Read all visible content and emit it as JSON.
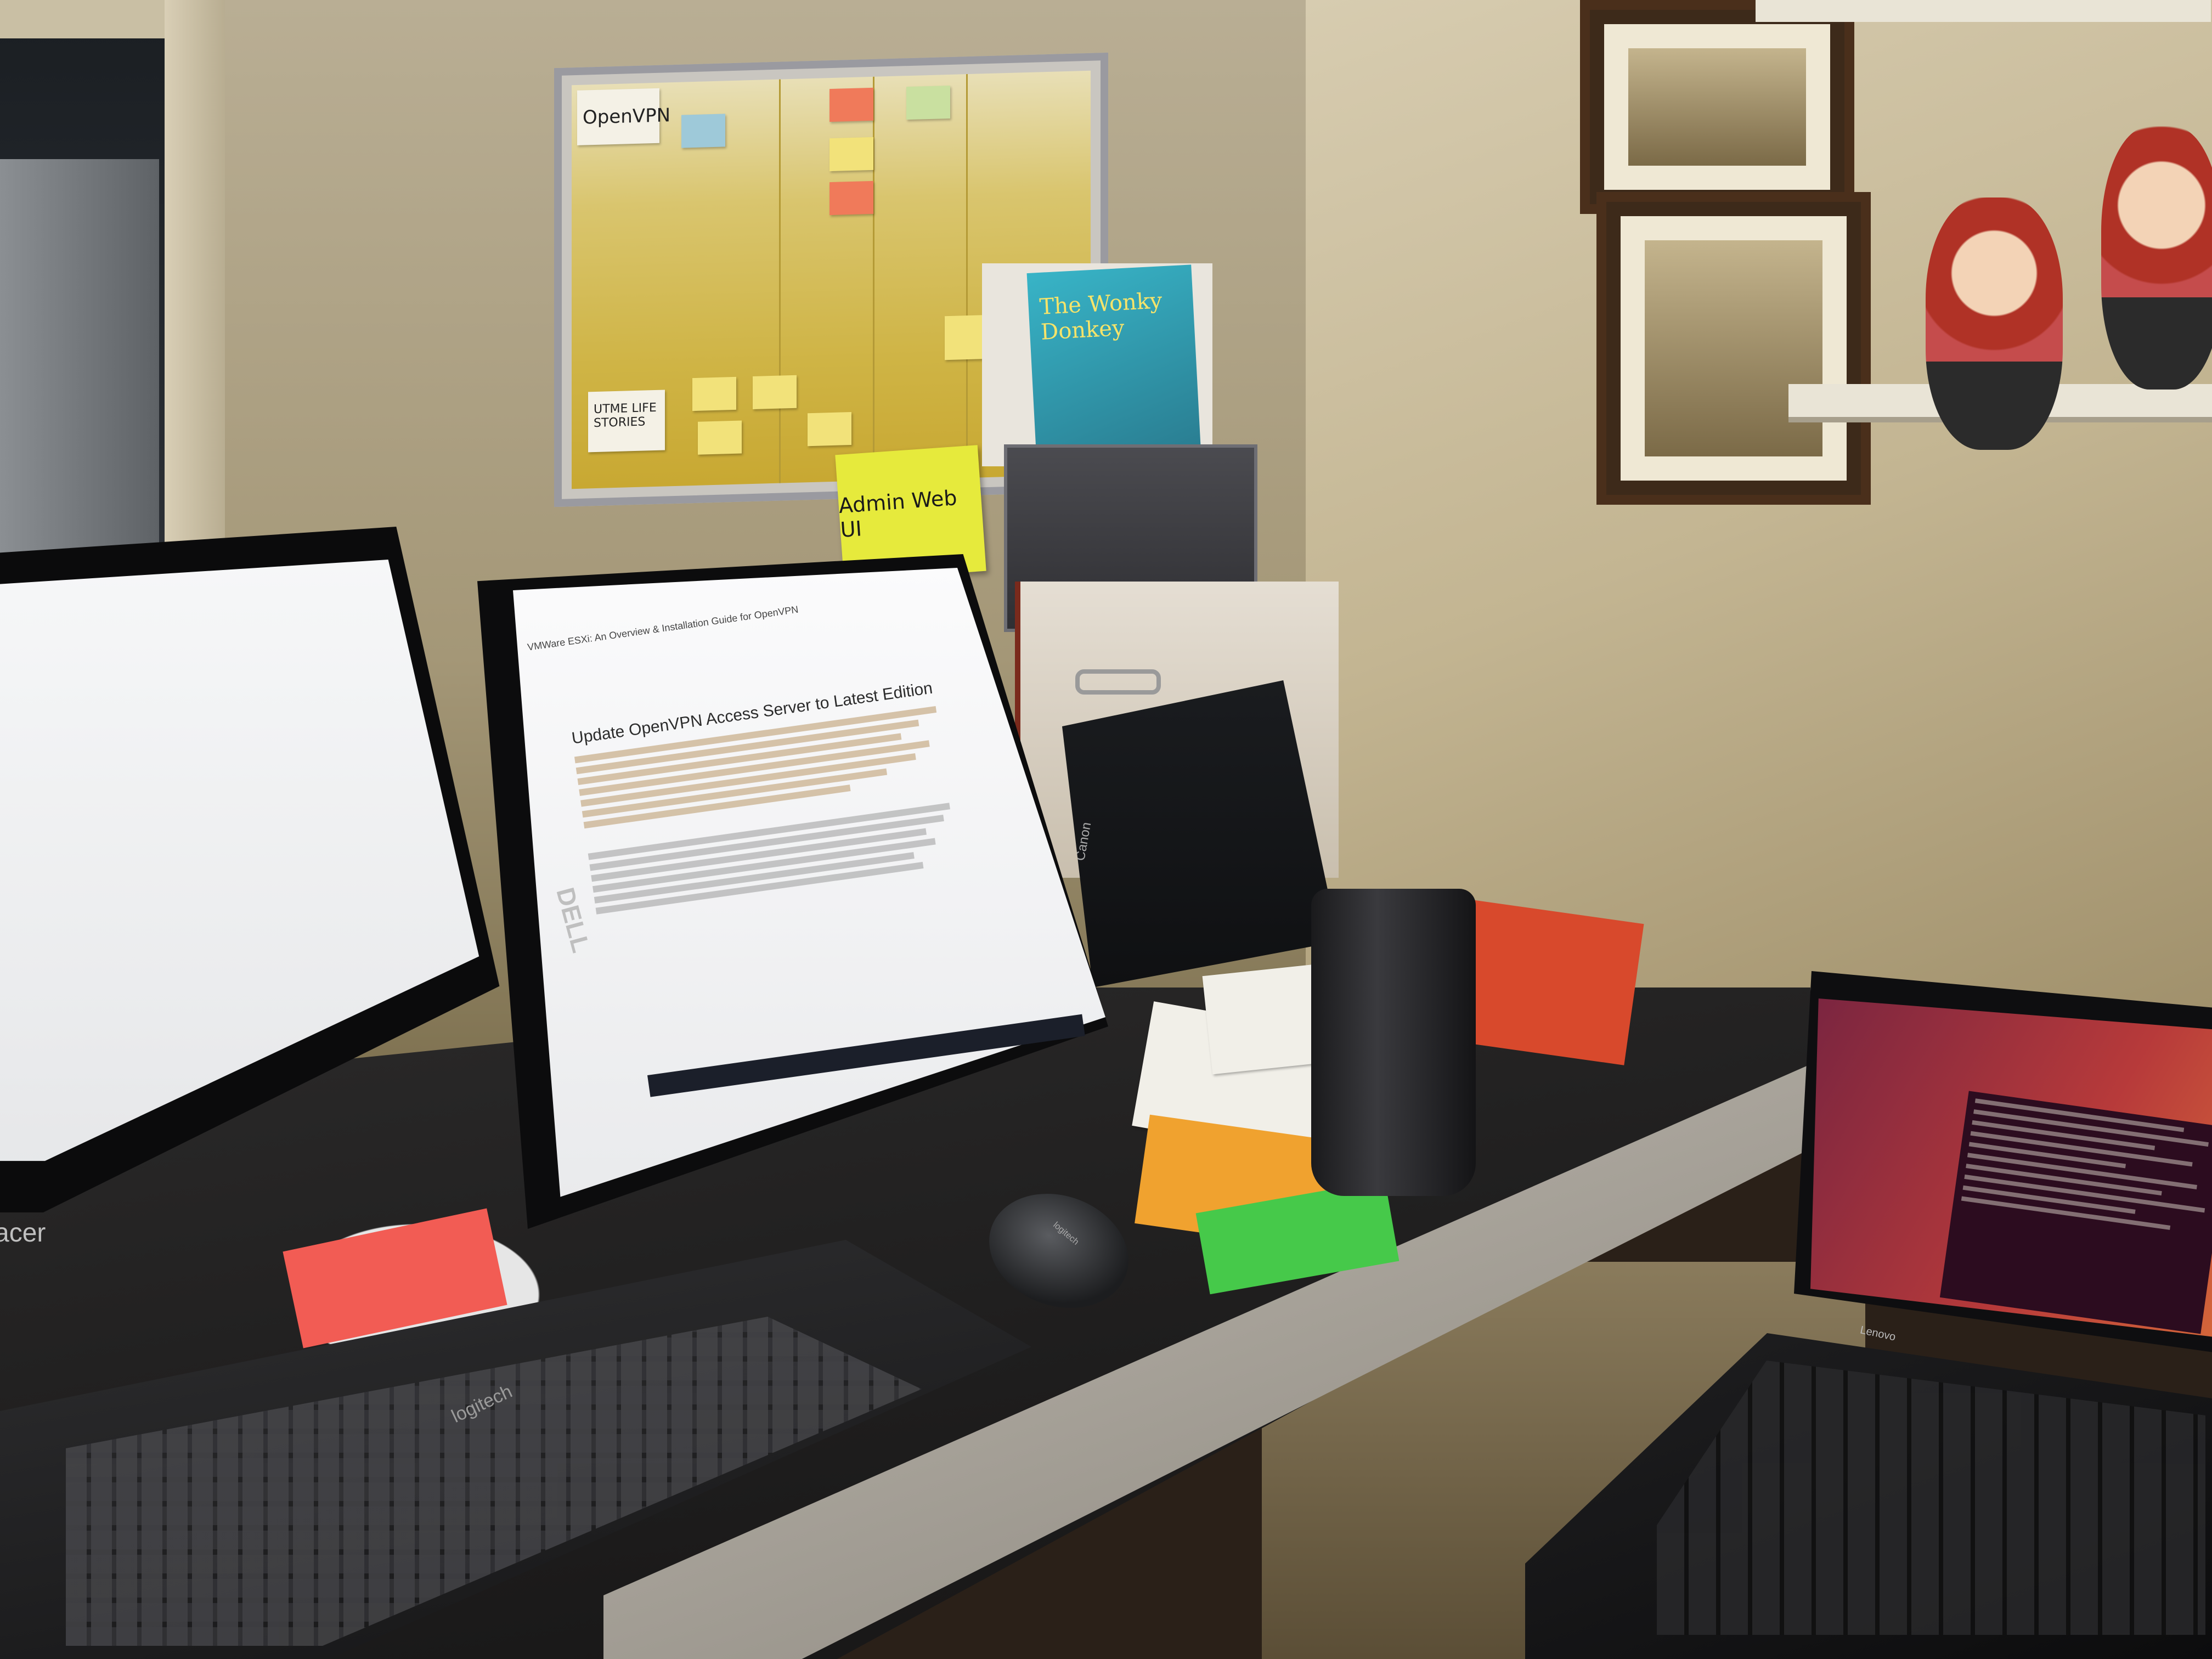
{
  "scene": {
    "board": {
      "header_label": "OpenVPN",
      "lower_label": "UTME LIFE STORIES"
    },
    "big_sticky": {
      "text": "Admin Web UI"
    },
    "book": {
      "title": "The Wonky Donkey"
    },
    "middle_monitor": {
      "brand": "DELL",
      "doc_tab": "VMWare ESXi: An Overview & Installation Guide for OpenVPN",
      "doc_title": "Update OpenVPN Access Server to Latest Edition"
    },
    "left_monitor": {
      "brand": "acer"
    },
    "keyboard": {
      "brand": "logitech"
    },
    "mouse": {
      "brand": "logitech"
    },
    "scanner": {
      "brand": "Canon"
    },
    "laptop": {
      "brand": "Lenovo"
    }
  },
  "colors": {
    "sticky_yellow": "#e6ea3c",
    "sticky_green": "#46c94a",
    "sticky_orange": "#f0a22f",
    "sticky_pink": "#f25c54",
    "ubuntu_orange": "#d5673a"
  }
}
